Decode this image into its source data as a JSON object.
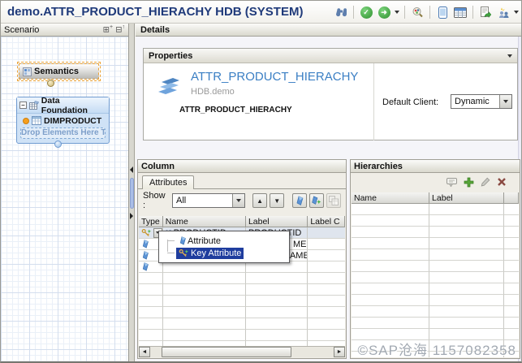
{
  "window": {
    "title": "demo.ATTR_PRODUCT_HIERACHY HDB (SYSTEM)"
  },
  "toolbar": {
    "icons": [
      "find-icon",
      "validate-icon",
      "activate-icon",
      "activate-menu-caret",
      "where-used-icon",
      "mobile-preview-icon",
      "data-preview-icon",
      "export-icon",
      "generate-docs-icon",
      "toolbar-overflow-caret"
    ]
  },
  "glyphs": {
    "caret_down": "▼",
    "arrow_up": "▲",
    "arrow_down": "▼",
    "scroll_left": "◄",
    "scroll_right": "►",
    "collapse_minus": "−",
    "expand_all": "⊞",
    "collapse_all": "⊟",
    "expand_plus": "+",
    "collapse_arrow": "↑",
    "check": "✓",
    "play": "➜"
  },
  "scenario": {
    "title": "Scenario",
    "semantics_label": "Semantics",
    "data_foundation_label": "Data Foundation",
    "table_name": "DIMPRODUCT",
    "drop_hint": "Drop Elements Here T..."
  },
  "details": {
    "title": "Details",
    "properties": {
      "title": "Properties",
      "view_name": "ATTR_PRODUCT_HIERACHY",
      "package": "HDB.demo",
      "technical_name": "ATTR_PRODUCT_HIERACHY",
      "default_client_label": "Default Client:",
      "default_client_value": "Dynamic"
    },
    "column": {
      "title": "Column",
      "tab_label": "Attributes",
      "show_label": "Show :",
      "show_value": "All",
      "table": {
        "headers": [
          "Type",
          "Name",
          "Label",
          "Label C"
        ],
        "rows": [
          {
            "type": "key-attribute",
            "name": "PRODUCTID",
            "label": "PRODUCTID"
          },
          {
            "type": "attribute",
            "label_partial": "ME"
          },
          {
            "type": "attribute",
            "label_partial": "AME"
          },
          {
            "type": "attribute",
            "label_partial": ""
          }
        ]
      },
      "type_menu": {
        "items": [
          {
            "label": "Attribute",
            "selected": false
          },
          {
            "label": "Key Attribute",
            "selected": true
          }
        ]
      }
    },
    "hierarchies": {
      "title": "Hierarchies",
      "headers": [
        "Name",
        "Label"
      ],
      "toolbar_icons": [
        "callout-icon",
        "add-icon",
        "edit-icon",
        "delete-icon"
      ]
    }
  },
  "watermark": "©SAP沧海 1157082358",
  "colors": {
    "title_blue": "#1f3a7a",
    "accent_blue": "#3b7fc4",
    "selection_navy": "#1f3d9e",
    "df_blue": "#cfe2f6",
    "selection_orange": "#eda335",
    "marker_orange": "#f59f1e",
    "ok_green": "#2e8f2e",
    "add_green": "#57a639"
  }
}
